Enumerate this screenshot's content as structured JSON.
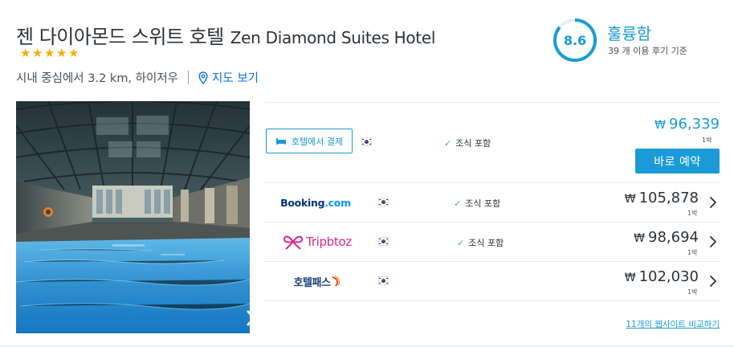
{
  "hotel": {
    "name_ko": "젠 다이아몬드 스위트 호텔",
    "name_en": "Zen Diamond Suites Hotel",
    "stars": 5,
    "location_text": "시내 중심에서 3.2 km, 하이저우",
    "map_link": "지도 보기"
  },
  "rating": {
    "score": "8.6",
    "label": "훌륭함",
    "reviews": "39 개 이용 후기 기준"
  },
  "featured_deal": {
    "pay_label": "호텔에서 결제",
    "flag": "KR",
    "breakfast": "조식 포함",
    "currency": "₩",
    "price": "96,339",
    "per_night": "1박",
    "book_label": "바로 예약"
  },
  "providers": [
    {
      "name": "Booking.com",
      "logo_part1": "Booking",
      "logo_part2": ".com",
      "flag": "KR",
      "breakfast": "조식 포함",
      "currency": "₩",
      "price": "105,878",
      "per_night": "1박"
    },
    {
      "name": "Tripbtoz",
      "logo_text": "Tripbtoz",
      "flag": "KR",
      "breakfast": "조식 포함",
      "currency": "₩",
      "price": "98,694",
      "per_night": "1박"
    },
    {
      "name": "호텔패스",
      "logo_text": "호텔패스",
      "flag": "KR",
      "breakfast": "",
      "currency": "₩",
      "price": "102,030",
      "per_night": "1박"
    }
  ],
  "compare_link": "11개의 웹사이트 비교하기",
  "colors": {
    "accent": "#1a9bd7",
    "check_green": "#3cb46e",
    "star": "#f5b100",
    "booking_blue": "#003580",
    "booking_light": "#0896ff",
    "tripbtoz": "#d8298f"
  },
  "icons": {
    "map": "map-pin-icon",
    "pay": "bed-icon",
    "next": "chevron-right-icon",
    "check": "check-icon"
  }
}
